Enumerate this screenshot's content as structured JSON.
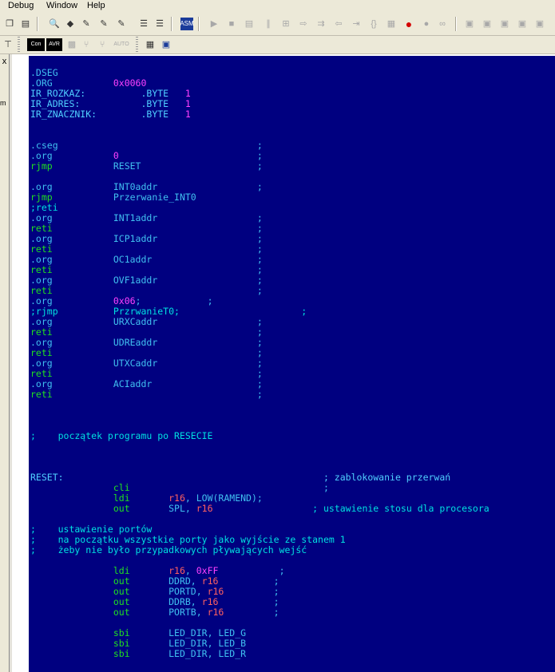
{
  "menu": {
    "debug": "Debug",
    "window": "Window",
    "help": "Help"
  },
  "toolbar2": {
    "con_label": "Con",
    "avr_label": "AVR",
    "auto_label": "AUTO"
  },
  "left_panel": {
    "close": "x",
    "partial_text": "m"
  },
  "colors": {
    "editor_bg": "#000080",
    "directive": "#40c0f0",
    "number": "#ff40ff",
    "instruction": "#20e020",
    "register": "#ff6060",
    "comment": "#00e0e0"
  },
  "code": {
    "lines": [
      [
        {
          "t": ".DSEG",
          "c": "dir"
        }
      ],
      [
        {
          "t": ".ORG           ",
          "c": "dir"
        },
        {
          "t": "0x0060",
          "c": "num"
        }
      ],
      [
        {
          "t": "IR_ROZKAZ:          .BYTE   ",
          "c": "lab"
        },
        {
          "t": "1",
          "c": "num"
        }
      ],
      [
        {
          "t": "IR_ADRES:           .BYTE   ",
          "c": "lab"
        },
        {
          "t": "1",
          "c": "num"
        }
      ],
      [
        {
          "t": "IR_ZNACZNIK:        .BYTE   ",
          "c": "lab"
        },
        {
          "t": "1",
          "c": "num"
        }
      ],
      [],
      [],
      [
        {
          "t": ".cseg                                    ;",
          "c": "dir"
        }
      ],
      [
        {
          "t": ".org           ",
          "c": "dir"
        },
        {
          "t": "0",
          "c": "num"
        },
        {
          "t": "                         ;",
          "c": "op"
        }
      ],
      [
        {
          "t": "rjmp           ",
          "c": "ins"
        },
        {
          "t": "RESET                     ;",
          "c": "op"
        }
      ],
      [],
      [
        {
          "t": ".org           INT0addr                  ;",
          "c": "dir"
        }
      ],
      [
        {
          "t": "rjmp           ",
          "c": "ins"
        },
        {
          "t": "Przerwanie_INT0",
          "c": "op"
        }
      ],
      [
        {
          "t": ";reti",
          "c": "com"
        }
      ],
      [
        {
          "t": ".org           INT1addr                  ;",
          "c": "dir"
        }
      ],
      [
        {
          "t": "reti",
          "c": "ins"
        },
        {
          "t": "                                     ;",
          "c": "op"
        }
      ],
      [
        {
          "t": ".org           ICP1addr                  ;",
          "c": "dir"
        }
      ],
      [
        {
          "t": "reti",
          "c": "ins"
        },
        {
          "t": "                                     ;",
          "c": "op"
        }
      ],
      [
        {
          "t": ".org           OC1addr                   ;",
          "c": "dir"
        }
      ],
      [
        {
          "t": "reti",
          "c": "ins"
        },
        {
          "t": "                                     ;",
          "c": "op"
        }
      ],
      [
        {
          "t": ".org           OVF1addr                  ;",
          "c": "dir"
        }
      ],
      [
        {
          "t": "reti",
          "c": "ins"
        },
        {
          "t": "                                     ;",
          "c": "op"
        }
      ],
      [
        {
          "t": ".org           ",
          "c": "dir"
        },
        {
          "t": "0x06",
          "c": "num"
        },
        {
          "t": ";            ;",
          "c": "op"
        }
      ],
      [
        {
          "t": ";rjmp          PrzrwanieT0;                      ;",
          "c": "com"
        }
      ],
      [
        {
          "t": ".org           URXCaddr                  ;",
          "c": "dir"
        }
      ],
      [
        {
          "t": "reti",
          "c": "ins"
        },
        {
          "t": "                                     ;",
          "c": "op"
        }
      ],
      [
        {
          "t": ".org           UDREaddr                  ;",
          "c": "dir"
        }
      ],
      [
        {
          "t": "reti",
          "c": "ins"
        },
        {
          "t": "                                     ;",
          "c": "op"
        }
      ],
      [
        {
          "t": ".org           UTXCaddr                  ;",
          "c": "dir"
        }
      ],
      [
        {
          "t": "reti",
          "c": "ins"
        },
        {
          "t": "                                     ;",
          "c": "op"
        }
      ],
      [
        {
          "t": ".org           ACIaddr                   ;",
          "c": "dir"
        }
      ],
      [
        {
          "t": "reti",
          "c": "ins"
        },
        {
          "t": "                                     ;",
          "c": "op"
        }
      ],
      [],
      [],
      [],
      [
        {
          "t": ";    początek programu po RESECIE",
          "c": "com"
        }
      ],
      [],
      [],
      [],
      [
        {
          "t": "RESET:                                               ; zablokowanie przerwań",
          "c": "lab"
        }
      ],
      [
        {
          "t": "               ",
          "c": "op"
        },
        {
          "t": "cli",
          "c": "ins"
        },
        {
          "t": "                                   ;",
          "c": "op"
        }
      ],
      [
        {
          "t": "               ",
          "c": "op"
        },
        {
          "t": "ldi",
          "c": "ins"
        },
        {
          "t": "       ",
          "c": "op"
        },
        {
          "t": "r16",
          "c": "reg"
        },
        {
          "t": ", LOW(RAMEND);",
          "c": "op"
        }
      ],
      [
        {
          "t": "               ",
          "c": "op"
        },
        {
          "t": "out",
          "c": "ins"
        },
        {
          "t": "       SPL, ",
          "c": "op"
        },
        {
          "t": "r16",
          "c": "reg"
        },
        {
          "t": "                  ; ustawienie stosu dla procesora",
          "c": "com"
        }
      ],
      [],
      [
        {
          "t": ";    ustawienie portów",
          "c": "com"
        }
      ],
      [
        {
          "t": ";    na początku wszystkie porty jako wyjście ze stanem 1",
          "c": "com"
        }
      ],
      [
        {
          "t": ";    żeby nie było przypadkowych pływających wejść",
          "c": "com"
        }
      ],
      [],
      [
        {
          "t": "               ",
          "c": "op"
        },
        {
          "t": "ldi",
          "c": "ins"
        },
        {
          "t": "       ",
          "c": "op"
        },
        {
          "t": "r16",
          "c": "reg"
        },
        {
          "t": ", ",
          "c": "op"
        },
        {
          "t": "0xFF",
          "c": "num"
        },
        {
          "t": "           ;",
          "c": "op"
        }
      ],
      [
        {
          "t": "               ",
          "c": "op"
        },
        {
          "t": "out",
          "c": "ins"
        },
        {
          "t": "       DDRD, ",
          "c": "op"
        },
        {
          "t": "r16",
          "c": "reg"
        },
        {
          "t": "          ;",
          "c": "op"
        }
      ],
      [
        {
          "t": "               ",
          "c": "op"
        },
        {
          "t": "out",
          "c": "ins"
        },
        {
          "t": "       PORTD, ",
          "c": "op"
        },
        {
          "t": "r16",
          "c": "reg"
        },
        {
          "t": "         ;",
          "c": "op"
        }
      ],
      [
        {
          "t": "               ",
          "c": "op"
        },
        {
          "t": "out",
          "c": "ins"
        },
        {
          "t": "       DDRB, ",
          "c": "op"
        },
        {
          "t": "r16",
          "c": "reg"
        },
        {
          "t": "          ;",
          "c": "op"
        }
      ],
      [
        {
          "t": "               ",
          "c": "op"
        },
        {
          "t": "out",
          "c": "ins"
        },
        {
          "t": "       PORTB, ",
          "c": "op"
        },
        {
          "t": "r16",
          "c": "reg"
        },
        {
          "t": "         ;",
          "c": "op"
        }
      ],
      [],
      [
        {
          "t": "               ",
          "c": "op"
        },
        {
          "t": "sbi",
          "c": "ins"
        },
        {
          "t": "       LED_DIR, LED_G",
          "c": "op"
        }
      ],
      [
        {
          "t": "               ",
          "c": "op"
        },
        {
          "t": "sbi",
          "c": "ins"
        },
        {
          "t": "       LED_DIR, LED_B",
          "c": "op"
        }
      ],
      [
        {
          "t": "               ",
          "c": "op"
        },
        {
          "t": "sbi",
          "c": "ins"
        },
        {
          "t": "       LED_DIR, LED_R",
          "c": "op"
        }
      ]
    ]
  }
}
